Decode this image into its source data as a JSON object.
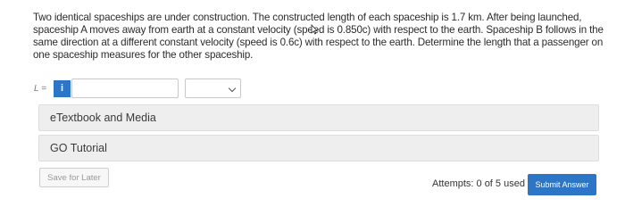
{
  "question": {
    "text": "Two identical spaceships are under construction. The constructed length of each spaceship is 1.7 km. After being launched, spaceship A moves away from earth at a constant velocity (speed is 0.850c) with respect to the earth. Spaceship B follows in the same direction at a different constant velocity (speed is 0.6c) with respect to the earth. Determine the length that a passenger on one spaceship measures for the other spaceship."
  },
  "answer": {
    "variable_label": "L =",
    "info_icon": "info-icon",
    "info_label": "i",
    "value": "",
    "unit_selected": ""
  },
  "panels": {
    "etextbook_label": "eTextbook and Media",
    "go_tutorial_label": "GO Tutorial"
  },
  "footer": {
    "save_label": "Save for Later",
    "attempts_text": "Attempts: 0 of 5 used",
    "submit_label": "Submit Answer"
  },
  "colors": {
    "accent": "#2c75c7",
    "panel_bg": "#eeeeee"
  }
}
